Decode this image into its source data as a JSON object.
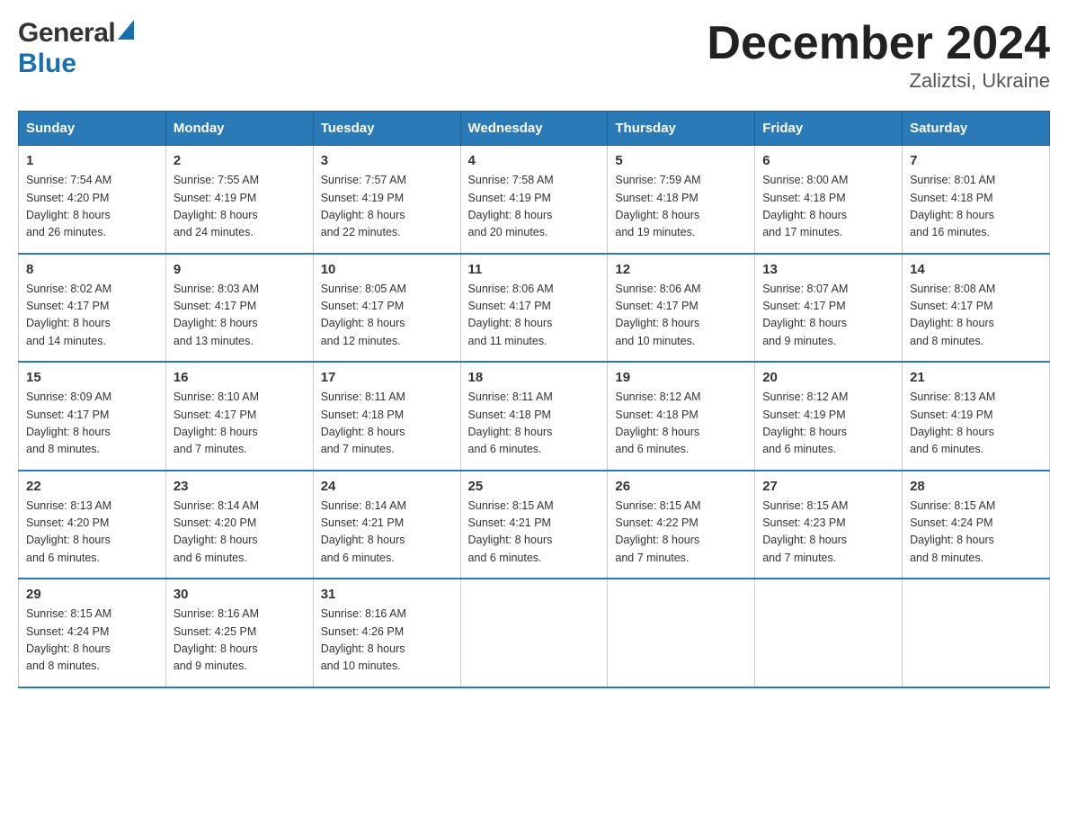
{
  "header": {
    "logo_line1": "General",
    "logo_line2": "Blue",
    "month_title": "December 2024",
    "location": "Zaliztsi, Ukraine"
  },
  "days_of_week": [
    "Sunday",
    "Monday",
    "Tuesday",
    "Wednesday",
    "Thursday",
    "Friday",
    "Saturday"
  ],
  "weeks": [
    [
      {
        "day": "1",
        "sunrise": "7:54 AM",
        "sunset": "4:20 PM",
        "daylight": "8 hours and 26 minutes."
      },
      {
        "day": "2",
        "sunrise": "7:55 AM",
        "sunset": "4:19 PM",
        "daylight": "8 hours and 24 minutes."
      },
      {
        "day": "3",
        "sunrise": "7:57 AM",
        "sunset": "4:19 PM",
        "daylight": "8 hours and 22 minutes."
      },
      {
        "day": "4",
        "sunrise": "7:58 AM",
        "sunset": "4:19 PM",
        "daylight": "8 hours and 20 minutes."
      },
      {
        "day": "5",
        "sunrise": "7:59 AM",
        "sunset": "4:18 PM",
        "daylight": "8 hours and 19 minutes."
      },
      {
        "day": "6",
        "sunrise": "8:00 AM",
        "sunset": "4:18 PM",
        "daylight": "8 hours and 17 minutes."
      },
      {
        "day": "7",
        "sunrise": "8:01 AM",
        "sunset": "4:18 PM",
        "daylight": "8 hours and 16 minutes."
      }
    ],
    [
      {
        "day": "8",
        "sunrise": "8:02 AM",
        "sunset": "4:17 PM",
        "daylight": "8 hours and 14 minutes."
      },
      {
        "day": "9",
        "sunrise": "8:03 AM",
        "sunset": "4:17 PM",
        "daylight": "8 hours and 13 minutes."
      },
      {
        "day": "10",
        "sunrise": "8:05 AM",
        "sunset": "4:17 PM",
        "daylight": "8 hours and 12 minutes."
      },
      {
        "day": "11",
        "sunrise": "8:06 AM",
        "sunset": "4:17 PM",
        "daylight": "8 hours and 11 minutes."
      },
      {
        "day": "12",
        "sunrise": "8:06 AM",
        "sunset": "4:17 PM",
        "daylight": "8 hours and 10 minutes."
      },
      {
        "day": "13",
        "sunrise": "8:07 AM",
        "sunset": "4:17 PM",
        "daylight": "8 hours and 9 minutes."
      },
      {
        "day": "14",
        "sunrise": "8:08 AM",
        "sunset": "4:17 PM",
        "daylight": "8 hours and 8 minutes."
      }
    ],
    [
      {
        "day": "15",
        "sunrise": "8:09 AM",
        "sunset": "4:17 PM",
        "daylight": "8 hours and 8 minutes."
      },
      {
        "day": "16",
        "sunrise": "8:10 AM",
        "sunset": "4:17 PM",
        "daylight": "8 hours and 7 minutes."
      },
      {
        "day": "17",
        "sunrise": "8:11 AM",
        "sunset": "4:18 PM",
        "daylight": "8 hours and 7 minutes."
      },
      {
        "day": "18",
        "sunrise": "8:11 AM",
        "sunset": "4:18 PM",
        "daylight": "8 hours and 6 minutes."
      },
      {
        "day": "19",
        "sunrise": "8:12 AM",
        "sunset": "4:18 PM",
        "daylight": "8 hours and 6 minutes."
      },
      {
        "day": "20",
        "sunrise": "8:12 AM",
        "sunset": "4:19 PM",
        "daylight": "8 hours and 6 minutes."
      },
      {
        "day": "21",
        "sunrise": "8:13 AM",
        "sunset": "4:19 PM",
        "daylight": "8 hours and 6 minutes."
      }
    ],
    [
      {
        "day": "22",
        "sunrise": "8:13 AM",
        "sunset": "4:20 PM",
        "daylight": "8 hours and 6 minutes."
      },
      {
        "day": "23",
        "sunrise": "8:14 AM",
        "sunset": "4:20 PM",
        "daylight": "8 hours and 6 minutes."
      },
      {
        "day": "24",
        "sunrise": "8:14 AM",
        "sunset": "4:21 PM",
        "daylight": "8 hours and 6 minutes."
      },
      {
        "day": "25",
        "sunrise": "8:15 AM",
        "sunset": "4:21 PM",
        "daylight": "8 hours and 6 minutes."
      },
      {
        "day": "26",
        "sunrise": "8:15 AM",
        "sunset": "4:22 PM",
        "daylight": "8 hours and 7 minutes."
      },
      {
        "day": "27",
        "sunrise": "8:15 AM",
        "sunset": "4:23 PM",
        "daylight": "8 hours and 7 minutes."
      },
      {
        "day": "28",
        "sunrise": "8:15 AM",
        "sunset": "4:24 PM",
        "daylight": "8 hours and 8 minutes."
      }
    ],
    [
      {
        "day": "29",
        "sunrise": "8:15 AM",
        "sunset": "4:24 PM",
        "daylight": "8 hours and 8 minutes."
      },
      {
        "day": "30",
        "sunrise": "8:16 AM",
        "sunset": "4:25 PM",
        "daylight": "8 hours and 9 minutes."
      },
      {
        "day": "31",
        "sunrise": "8:16 AM",
        "sunset": "4:26 PM",
        "daylight": "8 hours and 10 minutes."
      },
      {
        "day": "",
        "sunrise": "",
        "sunset": "",
        "daylight": ""
      },
      {
        "day": "",
        "sunrise": "",
        "sunset": "",
        "daylight": ""
      },
      {
        "day": "",
        "sunrise": "",
        "sunset": "",
        "daylight": ""
      },
      {
        "day": "",
        "sunrise": "",
        "sunset": "",
        "daylight": ""
      }
    ]
  ],
  "labels": {
    "sunrise": "Sunrise: ",
    "sunset": "Sunset: ",
    "daylight": "Daylight: "
  }
}
